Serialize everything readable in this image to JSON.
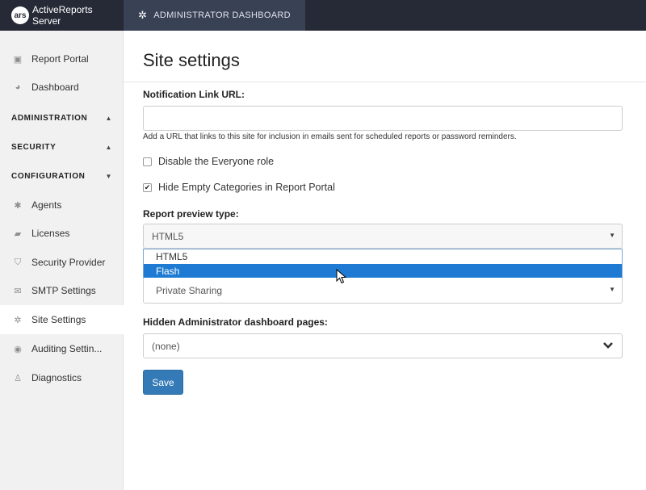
{
  "topbar": {
    "brand_logo": "ars",
    "brand_name": "ActiveReports Server",
    "admin_tab": "ADMINISTRATOR DASHBOARD"
  },
  "sidebar": {
    "report_portal": "Report Portal",
    "dashboard": "Dashboard",
    "administration": "ADMINISTRATION",
    "security": "SECURITY",
    "configuration": "CONFIGURATION",
    "agents": "Agents",
    "licenses": "Licenses",
    "security_provider": "Security Provider",
    "smtp_settings": "SMTP Settings",
    "site_settings": "Site Settings",
    "auditing_settings": "Auditing Settin...",
    "diagnostics": "Diagnostics"
  },
  "main": {
    "title": "Site settings",
    "notification_label": "Notification Link URL:",
    "notification_value": "",
    "notification_help": "Add a URL that links to this site for inclusion in emails sent for scheduled reports or password reminders.",
    "disable_everyone_label": "Disable the Everyone role",
    "disable_everyone_checked": false,
    "hide_empty_label": "Hide Empty Categories in Report Portal",
    "hide_empty_checked": true,
    "preview_type_label": "Report preview type:",
    "preview_type_value": "HTML5",
    "preview_options": [
      "HTML5",
      "Flash"
    ],
    "highlighted_option": "Flash",
    "sharing_value": "Private Sharing",
    "hidden_pages_label": "Hidden Administrator dashboard pages:",
    "hidden_pages_value": "(none)",
    "save_label": "Save"
  },
  "colors": {
    "topbar": "#252a36",
    "admin_tab": "#394155",
    "accent": "#337ab7",
    "highlight": "#1e7ad2"
  }
}
